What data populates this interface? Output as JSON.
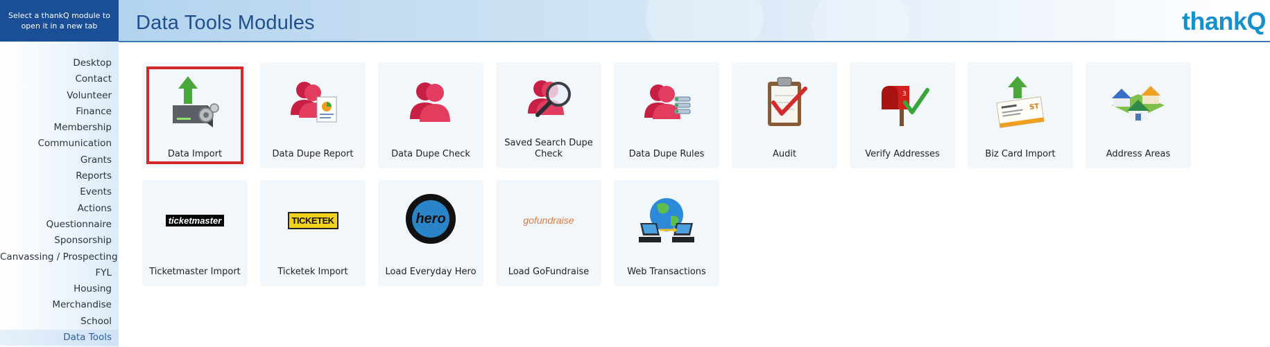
{
  "sidebar": {
    "hint": "Select a thankQ module to open it in a new tab",
    "items": [
      {
        "label": "Desktop"
      },
      {
        "label": "Contact"
      },
      {
        "label": "Volunteer"
      },
      {
        "label": "Finance"
      },
      {
        "label": "Membership"
      },
      {
        "label": "Communication"
      },
      {
        "label": "Grants"
      },
      {
        "label": "Reports"
      },
      {
        "label": "Events"
      },
      {
        "label": "Actions"
      },
      {
        "label": "Questionnaire"
      },
      {
        "label": "Sponsorship"
      },
      {
        "label": "Canvassing / Prospecting"
      },
      {
        "label": "FYL"
      },
      {
        "label": "Housing"
      },
      {
        "label": "Merchandise"
      },
      {
        "label": "School"
      },
      {
        "label": "Data Tools"
      }
    ],
    "active": "Data Tools"
  },
  "header": {
    "title": "Data Tools Modules",
    "logo": "thankQ"
  },
  "modules": [
    {
      "label": "Data Import",
      "icon": "server-import-icon",
      "selected": true
    },
    {
      "label": "Data Dupe Report",
      "icon": "dupe-report-icon"
    },
    {
      "label": "Data Dupe Check",
      "icon": "dupe-check-icon"
    },
    {
      "label": "Saved Search Dupe Check",
      "icon": "saved-search-icon"
    },
    {
      "label": "Data Dupe Rules",
      "icon": "dupe-rules-icon"
    },
    {
      "label": "Audit",
      "icon": "clipboard-check-icon"
    },
    {
      "label": "Verify Addresses",
      "icon": "mailbox-icon"
    },
    {
      "label": "Biz Card Import",
      "icon": "business-card-icon"
    },
    {
      "label": "Address Areas",
      "icon": "houses-icon"
    },
    {
      "label": "Ticketmaster Import",
      "icon": "ticketmaster-logo",
      "logo_text": "ticketmaster"
    },
    {
      "label": "Ticketek Import",
      "icon": "ticketek-logo",
      "logo_text": "TICKETEK"
    },
    {
      "label": "Load Everyday Hero",
      "icon": "everyday-hero-logo",
      "logo_text": "hero"
    },
    {
      "label": "Load GoFundraise",
      "icon": "gofundraise-logo",
      "logo_text": "gofundraise"
    },
    {
      "label": "Web Transactions",
      "icon": "globe-network-icon"
    }
  ],
  "colors": {
    "accent": "#1a4e96",
    "title": "#1f4f8e",
    "logo": "#1591cc",
    "selection": "#d42a2a",
    "tile": "#f2f7fc"
  }
}
